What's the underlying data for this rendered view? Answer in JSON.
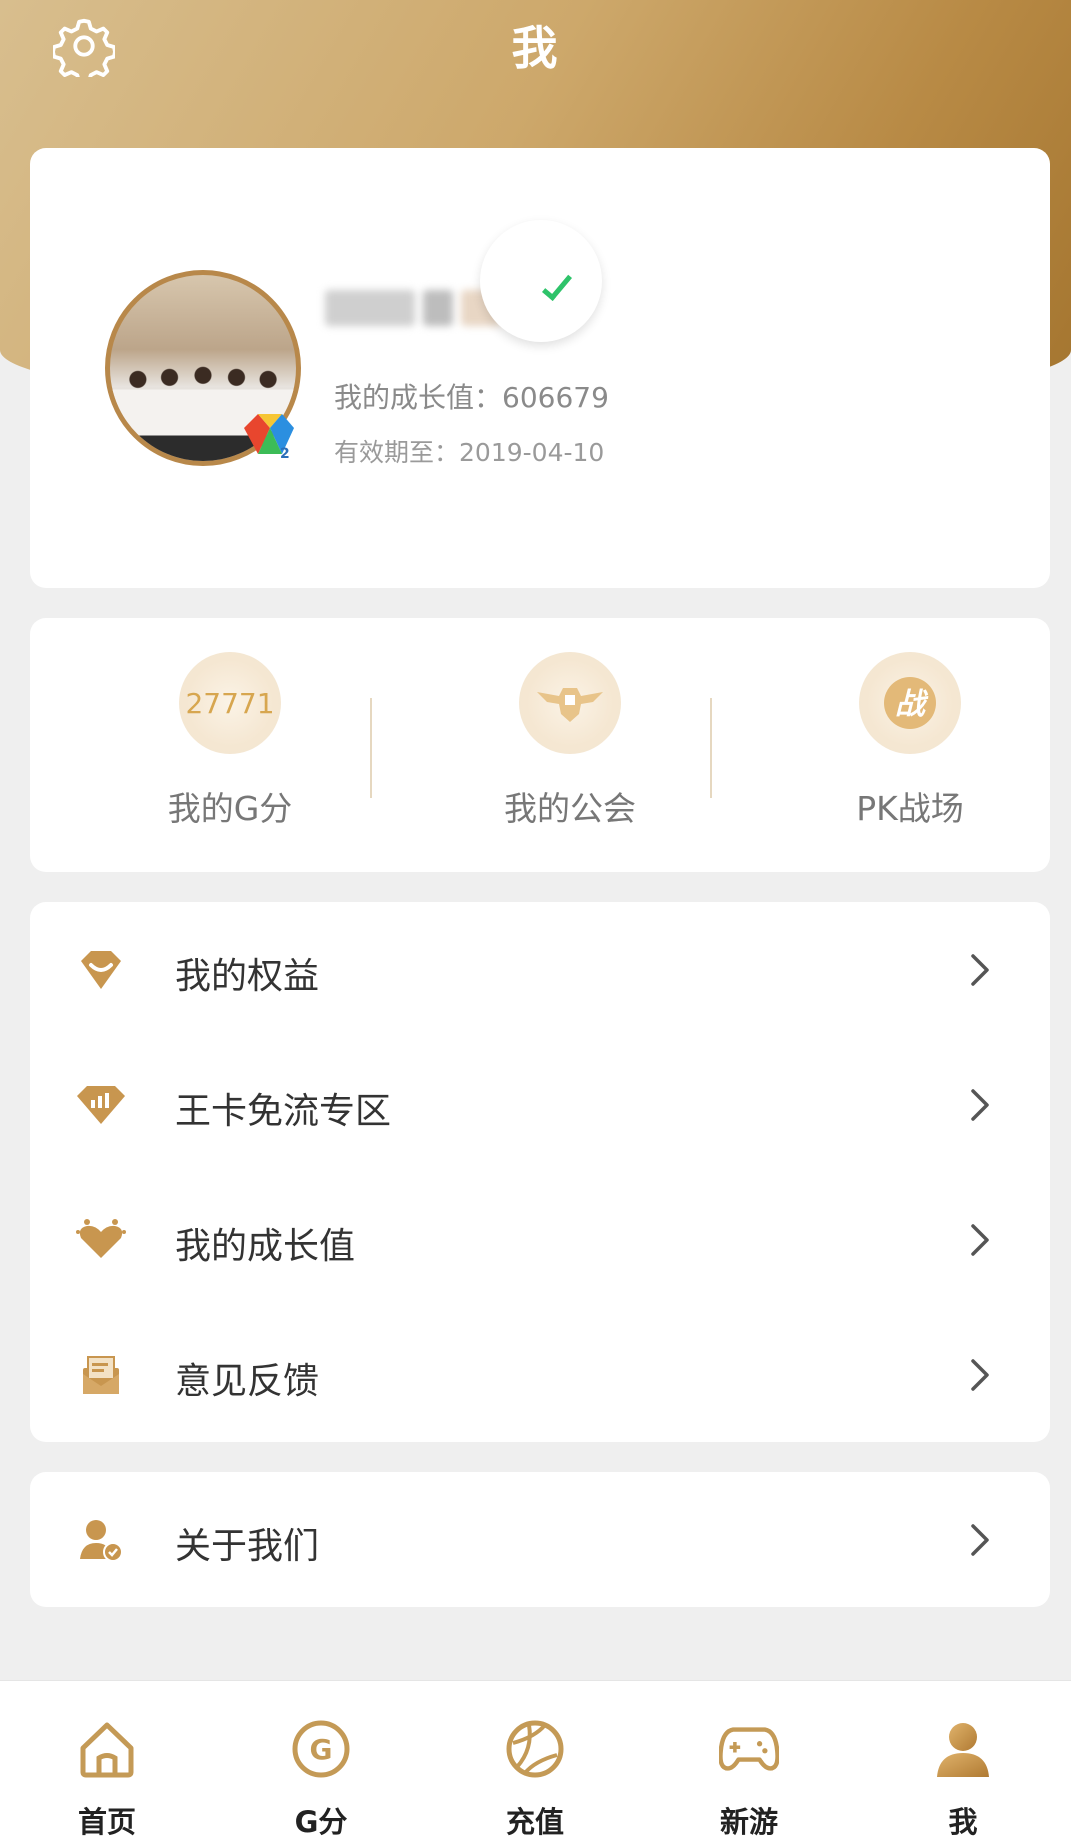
{
  "header": {
    "title": "我",
    "settings_icon": "gear-icon"
  },
  "profile": {
    "growth_label": "我的成长值：",
    "growth_value": "606679",
    "expire_label": "有效期至：",
    "expire_value": "2019-04-10"
  },
  "stats": [
    {
      "label": "我的G分",
      "value": "27771",
      "icon": "g-score-diamond-icon"
    },
    {
      "label": "我的公会",
      "icon": "guild-wings-icon"
    },
    {
      "label": "PK战场",
      "icon": "pk-battle-icon"
    }
  ],
  "menu": [
    {
      "label": "我的权益",
      "icon": "benefits-gem-icon"
    },
    {
      "label": "王卡免流专区",
      "icon": "data-free-zone-icon"
    },
    {
      "label": "我的成长值",
      "icon": "growth-heart-icon"
    },
    {
      "label": "意见反馈",
      "icon": "feedback-envelope-icon"
    }
  ],
  "about": {
    "label": "关于我们",
    "icon": "about-user-icon"
  },
  "bottom_nav": [
    {
      "label": "首页",
      "icon": "home-icon"
    },
    {
      "label": "G分",
      "icon": "g-score-icon"
    },
    {
      "label": "充值",
      "icon": "recharge-icon"
    },
    {
      "label": "新游",
      "icon": "gamepad-icon"
    },
    {
      "label": "我",
      "icon": "user-icon",
      "active": true
    }
  ],
  "colors": {
    "gold": "#c49a56",
    "gold_dark": "#a4752f",
    "accent_green": "#2ec36a"
  }
}
